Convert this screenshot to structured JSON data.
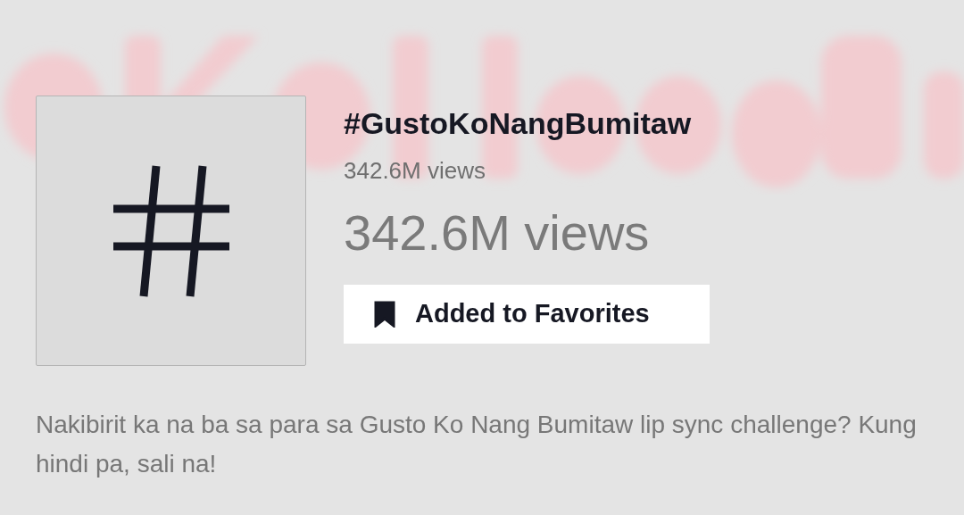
{
  "hashtag": {
    "title": "#GustoKoNangBumitaw",
    "views": "342.6M views",
    "views_large": "342.6M views"
  },
  "favorite_button": {
    "label": "Added to Favorites",
    "selected": true
  },
  "description": "Nakibirit ka na ba sa para sa Gusto Ko Nang Bumitaw lip sync challenge? Kung hindi pa, sali na!"
}
